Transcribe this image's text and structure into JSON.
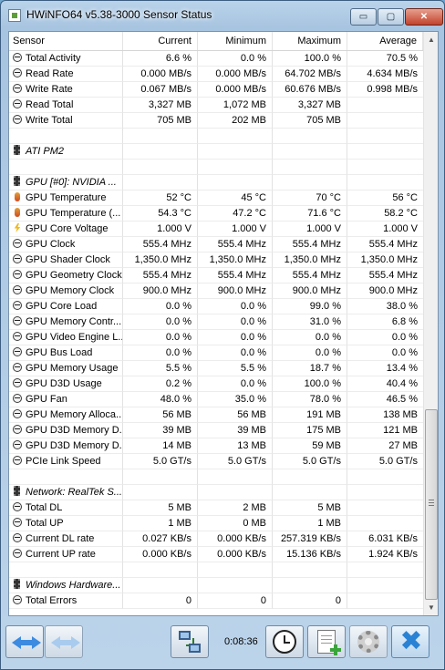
{
  "window": {
    "title": "HWiNFO64 v5.38-3000 Sensor Status",
    "controls": {
      "minimize": "▭",
      "maximize": "▢",
      "close": "✕"
    }
  },
  "columns": [
    "Sensor",
    "Current",
    "Minimum",
    "Maximum",
    "Average"
  ],
  "rows": [
    {
      "icon": "gauge-icon",
      "cells": [
        "Total Activity",
        "6.6 %",
        "0.0 %",
        "100.0 %",
        "70.5 %"
      ]
    },
    {
      "icon": "gauge-icon",
      "cells": [
        "Read Rate",
        "0.000 MB/s",
        "0.000 MB/s",
        "64.702 MB/s",
        "4.634 MB/s"
      ]
    },
    {
      "icon": "gauge-icon",
      "cells": [
        "Write Rate",
        "0.067 MB/s",
        "0.000 MB/s",
        "60.676 MB/s",
        "0.998 MB/s"
      ]
    },
    {
      "icon": "gauge-icon",
      "cells": [
        "Read Total",
        "3,327 MB",
        "1,072 MB",
        "3,327 MB",
        ""
      ]
    },
    {
      "icon": "gauge-icon",
      "cells": [
        "Write Total",
        "705 MB",
        "202 MB",
        "705 MB",
        ""
      ]
    },
    {
      "icon": "",
      "cells": [
        "",
        "",
        "",
        "",
        ""
      ]
    },
    {
      "icon": "chip-icon",
      "group": true,
      "cells": [
        "ATI PM2",
        "",
        "",
        "",
        ""
      ]
    },
    {
      "icon": "",
      "cells": [
        "",
        "",
        "",
        "",
        ""
      ]
    },
    {
      "icon": "chip-icon",
      "group": true,
      "cells": [
        "GPU [#0]: NVIDIA ...",
        "",
        "",
        "",
        ""
      ]
    },
    {
      "icon": "thermometer-icon",
      "cells": [
        "GPU Temperature",
        "52 °C",
        "45 °C",
        "70 °C",
        "56 °C"
      ]
    },
    {
      "icon": "thermometer-icon",
      "cells": [
        "GPU Temperature (...",
        "54.3 °C",
        "47.2 °C",
        "71.6 °C",
        "58.2 °C"
      ]
    },
    {
      "icon": "voltage-icon",
      "cells": [
        "GPU Core Voltage",
        "1.000 V",
        "1.000 V",
        "1.000 V",
        "1.000 V"
      ]
    },
    {
      "icon": "gauge-icon",
      "cells": [
        "GPU Clock",
        "555.4 MHz",
        "555.4 MHz",
        "555.4 MHz",
        "555.4 MHz"
      ]
    },
    {
      "icon": "gauge-icon",
      "cells": [
        "GPU Shader Clock",
        "1,350.0 MHz",
        "1,350.0 MHz",
        "1,350.0 MHz",
        "1,350.0 MHz"
      ]
    },
    {
      "icon": "gauge-icon",
      "cells": [
        "GPU Geometry Clock",
        "555.4 MHz",
        "555.4 MHz",
        "555.4 MHz",
        "555.4 MHz"
      ]
    },
    {
      "icon": "gauge-icon",
      "cells": [
        "GPU Memory Clock",
        "900.0 MHz",
        "900.0 MHz",
        "900.0 MHz",
        "900.0 MHz"
      ]
    },
    {
      "icon": "gauge-icon",
      "cells": [
        "GPU Core Load",
        "0.0 %",
        "0.0 %",
        "99.0 %",
        "38.0 %"
      ]
    },
    {
      "icon": "gauge-icon",
      "cells": [
        "GPU Memory Contr...",
        "0.0 %",
        "0.0 %",
        "31.0 %",
        "6.8 %"
      ]
    },
    {
      "icon": "gauge-icon",
      "cells": [
        "GPU Video Engine L...",
        "0.0 %",
        "0.0 %",
        "0.0 %",
        "0.0 %"
      ]
    },
    {
      "icon": "gauge-icon",
      "cells": [
        "GPU Bus Load",
        "0.0 %",
        "0.0 %",
        "0.0 %",
        "0.0 %"
      ]
    },
    {
      "icon": "gauge-icon",
      "cells": [
        "GPU Memory Usage",
        "5.5 %",
        "5.5 %",
        "18.7 %",
        "13.4 %"
      ]
    },
    {
      "icon": "gauge-icon",
      "cells": [
        "GPU D3D Usage",
        "0.2 %",
        "0.0 %",
        "100.0 %",
        "40.4 %"
      ]
    },
    {
      "icon": "gauge-icon",
      "cells": [
        "GPU Fan",
        "48.0 %",
        "35.0 %",
        "78.0 %",
        "46.5 %"
      ]
    },
    {
      "icon": "gauge-icon",
      "cells": [
        "GPU Memory Alloca...",
        "56 MB",
        "56 MB",
        "191 MB",
        "138 MB"
      ]
    },
    {
      "icon": "gauge-icon",
      "cells": [
        "GPU D3D Memory D...",
        "39 MB",
        "39 MB",
        "175 MB",
        "121 MB"
      ]
    },
    {
      "icon": "gauge-icon",
      "cells": [
        "GPU D3D Memory D...",
        "14 MB",
        "13 MB",
        "59 MB",
        "27 MB"
      ]
    },
    {
      "icon": "gauge-icon",
      "cells": [
        "PCIe Link Speed",
        "5.0 GT/s",
        "5.0 GT/s",
        "5.0 GT/s",
        "5.0 GT/s"
      ]
    },
    {
      "icon": "",
      "cells": [
        "",
        "",
        "",
        "",
        ""
      ]
    },
    {
      "icon": "chip-icon",
      "group": true,
      "cells": [
        "Network: RealTek S...",
        "",
        "",
        "",
        ""
      ]
    },
    {
      "icon": "gauge-icon",
      "cells": [
        "Total DL",
        "5 MB",
        "2 MB",
        "5 MB",
        ""
      ]
    },
    {
      "icon": "gauge-icon",
      "cells": [
        "Total UP",
        "1 MB",
        "0 MB",
        "1 MB",
        ""
      ]
    },
    {
      "icon": "gauge-icon",
      "cells": [
        "Current DL rate",
        "0.027 KB/s",
        "0.000 KB/s",
        "257.319 KB/s",
        "6.031 KB/s"
      ]
    },
    {
      "icon": "gauge-icon",
      "cells": [
        "Current UP rate",
        "0.000 KB/s",
        "0.000 KB/s",
        "15.136 KB/s",
        "1.924 KB/s"
      ]
    },
    {
      "icon": "",
      "cells": [
        "",
        "",
        "",
        "",
        ""
      ]
    },
    {
      "icon": "chip-icon",
      "group": true,
      "cells": [
        "Windows Hardware...",
        "",
        "",
        "",
        ""
      ]
    },
    {
      "icon": "gauge-icon",
      "cells": [
        "Total Errors",
        "0",
        "0",
        "0",
        ""
      ]
    }
  ],
  "scrollbar": {
    "up": "▲",
    "down": "▼"
  },
  "toolbar": {
    "elapsed": "0:08:36",
    "icons": [
      "expand-collapse-icon",
      "compact-icon",
      "network-icon",
      "clock-icon",
      "log-add-icon",
      "settings-gear-icon",
      "close-x-icon"
    ],
    "close_glyph": "✖"
  }
}
